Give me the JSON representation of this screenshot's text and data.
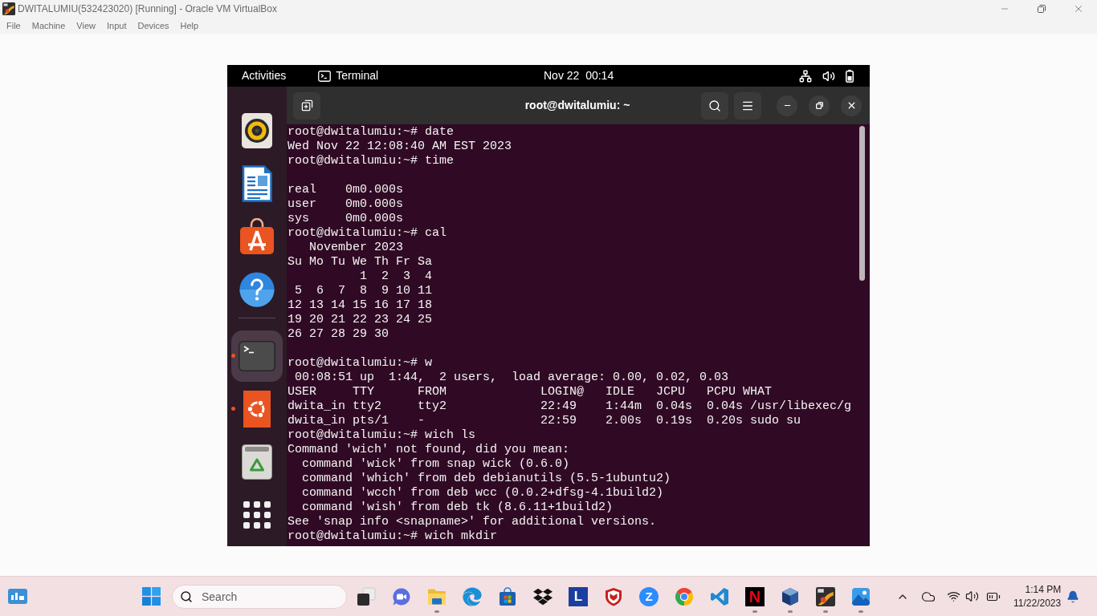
{
  "vm_window": {
    "title": "DWITALUMIU(532423020) [Running] - Oracle VM VirtualBox",
    "menu": [
      "File",
      "Machine",
      "View",
      "Input",
      "Devices",
      "Help"
    ]
  },
  "guest_top_bar": {
    "activities": "Activities",
    "app_menu": "Terminal",
    "clock": "Nov 22  00:14"
  },
  "dock": {
    "items": [
      {
        "running": false,
        "focused": false
      },
      {
        "running": false,
        "focused": false
      },
      {
        "running": false,
        "focused": false
      },
      {
        "running": false,
        "focused": false
      },
      {
        "running": true,
        "focused": true
      },
      {
        "running": true,
        "focused": false
      },
      {
        "running": false,
        "focused": false
      }
    ]
  },
  "terminal": {
    "title": "root@dwitalumiu: ~",
    "lines": [
      {
        "kind": "text",
        "text": "root@dwitalumiu:~# date"
      },
      {
        "kind": "text",
        "text": "Wed Nov 22 12:08:40 AM EST 2023"
      },
      {
        "kind": "text",
        "text": "root@dwitalumiu:~# time"
      },
      {
        "kind": "blank"
      },
      {
        "kind": "text",
        "text": "real    0m0.000s"
      },
      {
        "kind": "text",
        "text": "user    0m0.000s"
      },
      {
        "kind": "text",
        "text": "sys     0m0.000s"
      },
      {
        "kind": "text",
        "text": "root@dwitalumiu:~# cal"
      },
      {
        "kind": "text",
        "text": "   November 2023"
      },
      {
        "kind": "text",
        "text": "Su Mo Tu We Th Fr Sa"
      },
      {
        "kind": "text",
        "text": "          1  2  3  4"
      },
      {
        "kind": "text",
        "text": " 5  6  7  8  9 10 11"
      },
      {
        "kind": "text",
        "text": "12 13 14 15 16 17 18"
      },
      {
        "kind": "text",
        "text": "19 20 21 22 23 24 25"
      },
      {
        "kind": "text",
        "text": "26 27 28 29 30"
      },
      {
        "kind": "blank"
      },
      {
        "kind": "text",
        "text": "root@dwitalumiu:~# w"
      },
      {
        "kind": "text",
        "text": " 00:08:51 up  1:44,  2 users,  load average: 0.00, 0.02, 0.03"
      },
      {
        "kind": "text",
        "text": "USER     TTY      FROM             LOGIN@   IDLE   JCPU   PCPU WHAT"
      },
      {
        "kind": "text",
        "text": "dwita_in tty2     tty2             22:49    1:44m  0.04s  0.04s /usr/libexec/g"
      },
      {
        "kind": "text",
        "text": "dwita_in pts/1    -                22:59    2.00s  0.19s  0.20s sudo su"
      },
      {
        "kind": "text",
        "text": "root@dwitalumiu:~# wich ls"
      },
      {
        "kind": "text",
        "text": "Command 'wich' not found, did you mean:"
      },
      {
        "kind": "text",
        "text": "  command 'wick' from snap wick (0.6.0)"
      },
      {
        "kind": "text",
        "text": "  command 'which' from deb debianutils (5.5-1ubuntu2)"
      },
      {
        "kind": "text",
        "text": "  command 'wcch' from deb wcc (0.0.2+dfsg-4.1build2)"
      },
      {
        "kind": "text",
        "text": "  command 'wish' from deb tk (8.6.11+1build2)"
      },
      {
        "kind": "text",
        "text": "See 'snap info <snapname>' for additional versions."
      },
      {
        "kind": "text",
        "text": "root@dwitalumiu:~# wich mkdir"
      }
    ]
  },
  "taskbar": {
    "search": {
      "placeholder": "Search"
    },
    "apps": [
      {
        "running": false
      },
      {
        "running": false
      },
      {
        "running": true
      },
      {
        "running": false
      },
      {
        "running": false
      },
      {
        "running": false
      },
      {
        "running": false,
        "label": "L"
      },
      {
        "running": false
      },
      {
        "running": false,
        "label": "Z"
      },
      {
        "running": false
      },
      {
        "running": false
      },
      {
        "running": true,
        "label": "N"
      },
      {
        "running": true
      },
      {
        "running": true
      },
      {
        "running": true
      }
    ],
    "clock": {
      "time": "1:14 PM",
      "date": "11/22/2023"
    }
  }
}
